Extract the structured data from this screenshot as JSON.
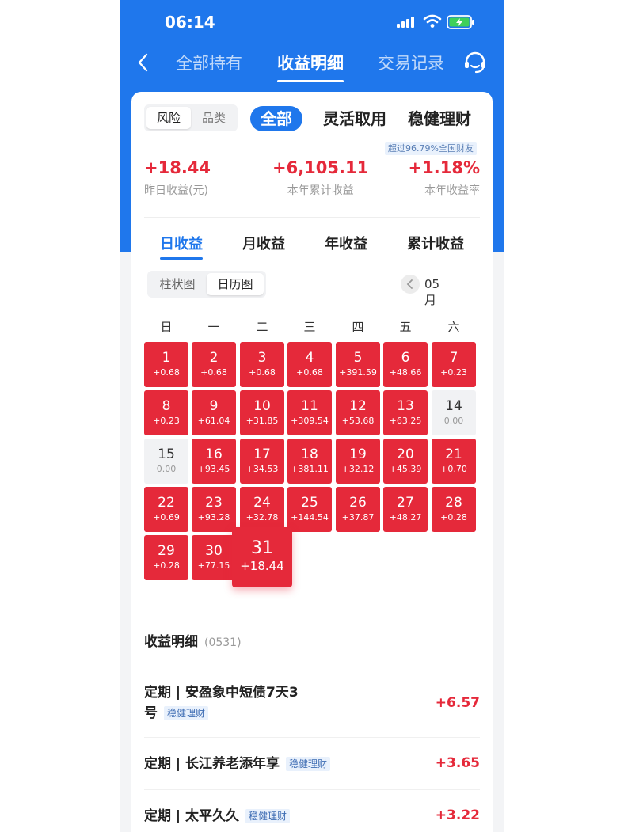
{
  "status": {
    "time": "06:14"
  },
  "nav": {
    "tabs": [
      "全部持有",
      "收益明细",
      "交易记录"
    ],
    "active": 1
  },
  "filter": {
    "segment": [
      "风险",
      "品类"
    ],
    "tabs": [
      "全部",
      "灵活取用",
      "稳健理财"
    ]
  },
  "summary": {
    "rank_badge": "超过96.79%全国财友",
    "stats": [
      {
        "value": "+18.44",
        "label": "昨日收益(元)"
      },
      {
        "value": "+6,105.11",
        "label": "本年累计收益"
      },
      {
        "value": "+1.18%",
        "label": "本年收益率"
      }
    ]
  },
  "period_tabs": [
    "日收益",
    "月收益",
    "年收益",
    "累计收益"
  ],
  "view_toggle": [
    "柱状图",
    "日历图"
  ],
  "month": "05月",
  "weekdays": [
    "日",
    "一",
    "二",
    "三",
    "四",
    "五",
    "六"
  ],
  "calendar": [
    {
      "day": "1",
      "amount": "+0.68"
    },
    {
      "day": "2",
      "amount": "+0.68"
    },
    {
      "day": "3",
      "amount": "+0.68"
    },
    {
      "day": "4",
      "amount": "+0.68"
    },
    {
      "day": "5",
      "amount": "+391.59"
    },
    {
      "day": "6",
      "amount": "+48.66"
    },
    {
      "day": "7",
      "amount": "+0.23"
    },
    {
      "day": "8",
      "amount": "+0.23"
    },
    {
      "day": "9",
      "amount": "+61.04"
    },
    {
      "day": "10",
      "amount": "+31.85"
    },
    {
      "day": "11",
      "amount": "+309.54"
    },
    {
      "day": "12",
      "amount": "+53.68"
    },
    {
      "day": "13",
      "amount": "+63.25"
    },
    {
      "day": "14",
      "amount": "0.00"
    },
    {
      "day": "15",
      "amount": "0.00"
    },
    {
      "day": "16",
      "amount": "+93.45"
    },
    {
      "day": "17",
      "amount": "+34.53"
    },
    {
      "day": "18",
      "amount": "+381.11"
    },
    {
      "day": "19",
      "amount": "+32.12"
    },
    {
      "day": "20",
      "amount": "+45.39"
    },
    {
      "day": "21",
      "amount": "+0.70"
    },
    {
      "day": "22",
      "amount": "+0.69"
    },
    {
      "day": "23",
      "amount": "+93.28"
    },
    {
      "day": "24",
      "amount": "+32.78"
    },
    {
      "day": "25",
      "amount": "+144.54"
    },
    {
      "day": "26",
      "amount": "+37.87"
    },
    {
      "day": "27",
      "amount": "+48.27"
    },
    {
      "day": "28",
      "amount": "+0.28"
    },
    {
      "day": "29",
      "amount": "+0.28"
    },
    {
      "day": "30",
      "amount": "+77.15"
    },
    {
      "day": "31",
      "amount": "+18.44"
    }
  ],
  "details": {
    "title": "收益明细",
    "code": "(0531)",
    "items": [
      {
        "name_line1": "定期 | 安盈象中短债7天3",
        "name_line2": "号",
        "tag": "稳健理财",
        "amount": "+6.57"
      },
      {
        "name": "定期 | 长江养老添年享",
        "tag": "稳健理财",
        "amount": "+3.65"
      },
      {
        "name": "定期 | 太平久久",
        "tag": "稳健理财",
        "amount": "+3.22"
      }
    ]
  }
}
